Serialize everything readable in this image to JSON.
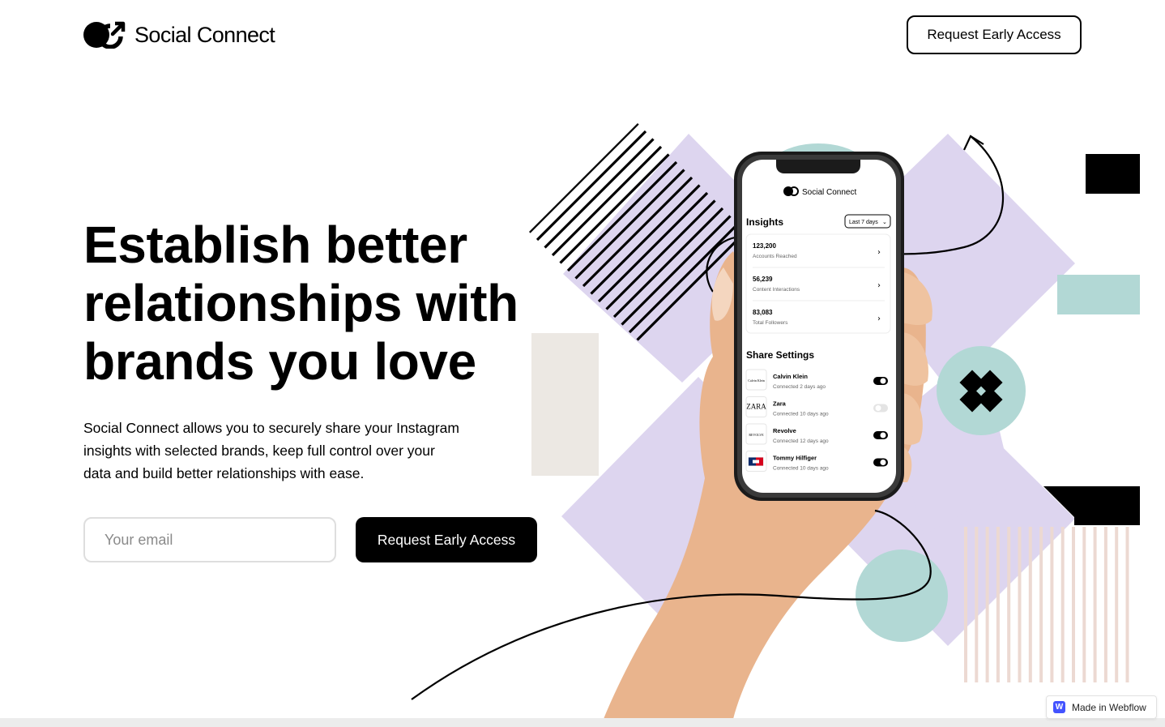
{
  "nav": {
    "brand_name": "Social Connect",
    "cta_label": "Request Early Access"
  },
  "hero": {
    "title_lines": [
      "Establish better",
      "relationships with",
      "brands you love"
    ],
    "subtitle_lines": [
      "Social Connect allows you to securely share your Instagram",
      "insights with selected brands, keep full control over your",
      "data and build better relationships with ease."
    ],
    "email_placeholder": "Your email",
    "cta_label": "Request Early Access"
  },
  "phone": {
    "brand_name": "Social Connect",
    "insights_title": "Insights",
    "period_select": "Last 7 days",
    "metrics": [
      {
        "value": "123,200",
        "label": "Accounts Reached"
      },
      {
        "value": "56,239",
        "label": "Content Interactions"
      },
      {
        "value": "83,083",
        "label": "Total Followers"
      }
    ],
    "share_title": "Share Settings",
    "brands": [
      {
        "name": "Calvin Klein",
        "status": "Connected 2 days ago",
        "enabled": true,
        "logo": "Calvin Klein"
      },
      {
        "name": "Zara",
        "status": "Connected 10 days ago",
        "enabled": false,
        "logo": "ZARA"
      },
      {
        "name": "Revolve",
        "status": "Connected 12 days ago",
        "enabled": true,
        "logo": "REVOLVE"
      },
      {
        "name": "Tommy Hilfiger",
        "status": "Connected 10 days ago",
        "enabled": true,
        "logo": "tommy-flag"
      }
    ]
  },
  "badge": {
    "label": "Made in Webflow",
    "logo_letter": "W"
  },
  "colors": {
    "lavender": "#ddd5ef",
    "mint": "#b2d8d5",
    "black": "#000000",
    "skin": "#e9b48d",
    "webflow_blue": "#4353ff"
  },
  "icons": [
    "social-connect-logo-icon",
    "chevron-right-icon",
    "chevron-down-icon",
    "toggle-icon",
    "arrow-up-icon",
    "webflow-icon"
  ]
}
